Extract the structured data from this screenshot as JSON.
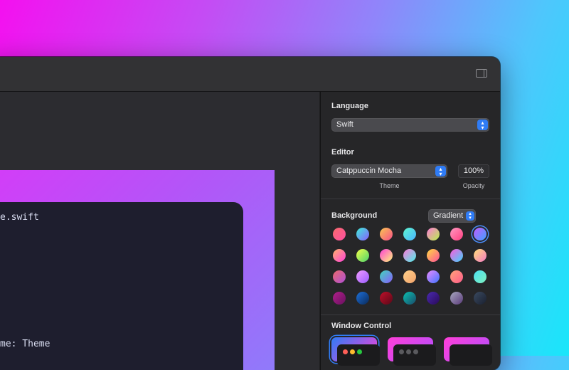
{
  "code": {
    "line1": "e.swift",
    "line2": "me: Theme"
  },
  "panel": {
    "language": {
      "title": "Language",
      "selected": "Swift"
    },
    "editor": {
      "title": "Editor",
      "theme_selected": "Catppuccin Mocha",
      "opacity_value": "100%",
      "theme_caption": "Theme",
      "opacity_caption": "Opacity"
    },
    "background": {
      "title": "Background",
      "mode_selected": "Gradient",
      "selected_index": 6,
      "swatches": [
        [
          "#f76b6b",
          "#ff4fa3"
        ],
        [
          "#3cf0d8",
          "#8a5cff"
        ],
        [
          "#f9c74f",
          "#f94f8a"
        ],
        [
          "#5ef6d0",
          "#49b3ff"
        ],
        [
          "#ff7ad9",
          "#b7f04a"
        ],
        [
          "#ff9ac2",
          "#ff3f80"
        ],
        [
          "#c05cff",
          "#3fa0ff"
        ],
        [
          "#ffb36b",
          "#ff3fd8"
        ],
        [
          "#f3ff4a",
          "#4ad36b"
        ],
        [
          "#ff3fd8",
          "#fff37a"
        ],
        [
          "#ff7ad9",
          "#4aefe8"
        ],
        [
          "#ffdb3f",
          "#ff4f9a"
        ],
        [
          "#ff5bd9",
          "#3fd4ff"
        ],
        [
          "#ffe07a",
          "#f37ac4"
        ],
        [
          "#e86a6a",
          "#b04fd8"
        ],
        [
          "#f09aff",
          "#9a5cff"
        ],
        [
          "#3fd8b8",
          "#8a5cff"
        ],
        [
          "#ffd08a",
          "#f3a36b"
        ],
        [
          "#e88aff",
          "#3f72ff"
        ],
        [
          "#ffa37a",
          "#ff5b8a"
        ],
        [
          "#4ae0f0",
          "#7ff0c0"
        ],
        [
          "#b0208a",
          "#6a1060"
        ],
        [
          "#1d6fd8",
          "#0a2a5a"
        ],
        [
          "#c0102a",
          "#5a0818"
        ],
        [
          "#0ac0b0",
          "#1a4a6a"
        ],
        [
          "#4a2ab0",
          "#2a0a5a"
        ],
        [
          "#a8a8c0",
          "#5a3a7a"
        ],
        [
          "#3a4a60",
          "#1a2030"
        ]
      ]
    },
    "window_control": {
      "title": "Window Control",
      "options": [
        {
          "dots": [
            "#ff5f57",
            "#febc2e",
            "#28c840"
          ],
          "frame": [
            "#2f7cf6",
            "#ff3fd8"
          ],
          "selected": true
        },
        {
          "dots": [
            "#5a5a5e",
            "#5a5a5e",
            "#5a5a5e"
          ],
          "frame": [
            "#ff3fd8",
            "#b04fff"
          ],
          "selected": false
        },
        {
          "dots": [],
          "frame": [
            "#ff3fd8",
            "#b04fff"
          ],
          "selected": false
        }
      ]
    }
  }
}
